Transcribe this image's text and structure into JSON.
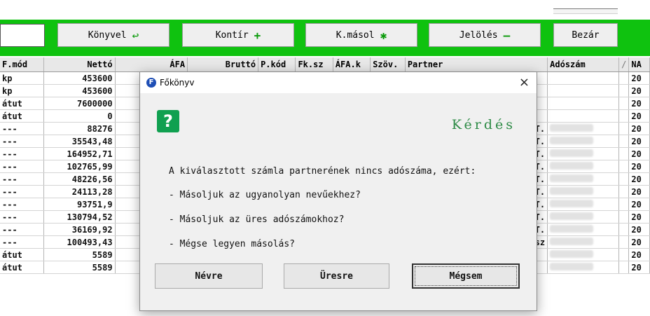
{
  "toolbar": {
    "buttons": [
      {
        "label": "Könyvel",
        "icon": "↩"
      },
      {
        "label": "Kontír",
        "icon": "+"
      },
      {
        "label": "K.másol",
        "icon": "✱"
      },
      {
        "label": "Jelölés",
        "icon": "—"
      },
      {
        "label": "Bezár",
        "icon": ""
      }
    ]
  },
  "grid": {
    "headers": [
      "F.mód",
      "Nettó",
      "ÁFA",
      "Bruttó",
      "P.kód",
      "Fk.sz",
      "ÁFA.k",
      "Szöv.",
      "Partner",
      "Adószám",
      "/",
      "NA"
    ],
    "rows": [
      {
        "fmod": "kp",
        "netto": "453600",
        "partner": "",
        "na": "20"
      },
      {
        "fmod": "kp",
        "netto": "453600",
        "partner": "",
        "na": "20"
      },
      {
        "fmod": "átut",
        "netto": "7600000",
        "partner": "",
        "na": "20"
      },
      {
        "fmod": "átut",
        "netto": "0",
        "partner": "",
        "na": "20"
      },
      {
        "fmod": "---",
        "netto": "88276",
        "partner": "FT.",
        "na": "20"
      },
      {
        "fmod": "---",
        "netto": "35543,48",
        "partner": "FT.",
        "na": "20"
      },
      {
        "fmod": "---",
        "netto": "164952,71",
        "partner": "FT.",
        "na": "20"
      },
      {
        "fmod": "---",
        "netto": "102765,99",
        "partner": "FT.",
        "na": "20"
      },
      {
        "fmod": "---",
        "netto": "48226,56",
        "partner": "FT.",
        "na": "20"
      },
      {
        "fmod": "---",
        "netto": "24113,28",
        "partner": "FT.",
        "na": "20"
      },
      {
        "fmod": "---",
        "netto": "93751,9",
        "partner": "FT.",
        "na": "20"
      },
      {
        "fmod": "---",
        "netto": "130794,52",
        "partner": "FT.",
        "na": "20"
      },
      {
        "fmod": "---",
        "netto": "36169,92",
        "partner": "FT.",
        "na": "20"
      },
      {
        "fmod": "---",
        "netto": "100493,43",
        "partner": "orsz",
        "na": "20"
      },
      {
        "fmod": "átut",
        "netto": "5589",
        "partner": "",
        "na": "20"
      },
      {
        "fmod": "átut",
        "netto": "5589",
        "partner": "",
        "na": "20"
      }
    ]
  },
  "dialog": {
    "title": "Főkönyv",
    "close": "×",
    "heading": "Kérdés",
    "lines": [
      "A kiválasztott számla partnerének nincs adószáma, ezért:",
      "- Másoljuk az ugyanolyan nevűekhez?",
      "- Másoljuk az üres adószámokhoz?",
      "- Mégse legyen másolás?"
    ],
    "buttons": [
      "Névre",
      "Üresre",
      "Mégsem"
    ]
  },
  "colors": {
    "toolbar_bg": "#0fc20f",
    "heading": "#2c8a45",
    "question_icon": "#10a050"
  }
}
